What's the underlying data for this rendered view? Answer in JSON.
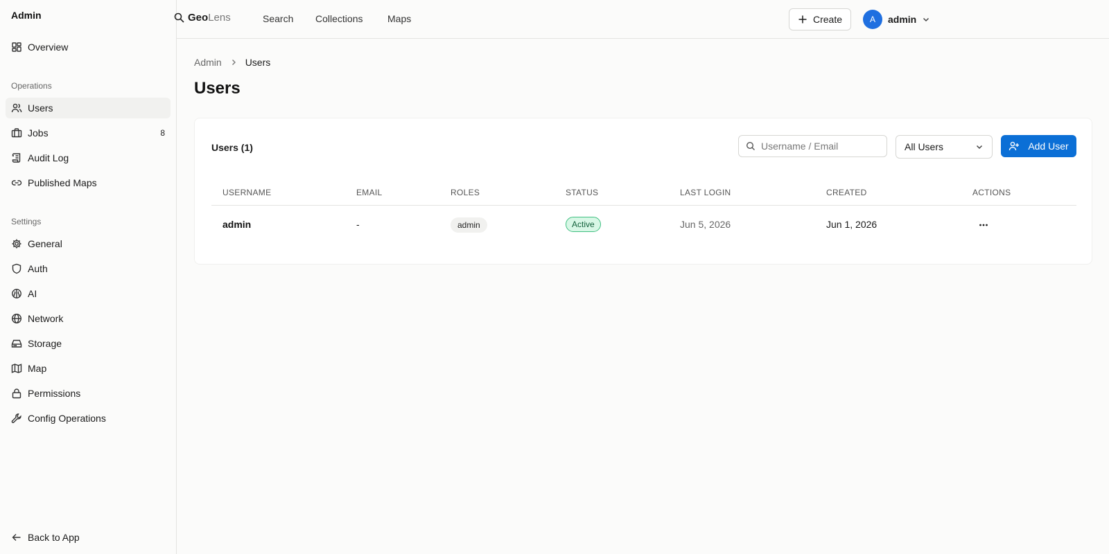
{
  "sidebar": {
    "title": "Admin",
    "overview": {
      "label": "Overview",
      "icon": "dashboard-icon"
    },
    "operations": {
      "heading": "Operations",
      "items": [
        {
          "label": "Users",
          "icon": "users-icon",
          "active": true
        },
        {
          "label": "Jobs",
          "icon": "briefcase-icon",
          "badge": "8"
        },
        {
          "label": "Audit Log",
          "icon": "scroll-icon"
        },
        {
          "label": "Published Maps",
          "icon": "link-icon"
        }
      ]
    },
    "settings": {
      "heading": "Settings",
      "items": [
        {
          "label": "General",
          "icon": "gear-icon"
        },
        {
          "label": "Auth",
          "icon": "shield-icon"
        },
        {
          "label": "AI",
          "icon": "brain-icon"
        },
        {
          "label": "Network",
          "icon": "globe-icon"
        },
        {
          "label": "Storage",
          "icon": "hard-drive-icon"
        },
        {
          "label": "Map",
          "icon": "map-icon"
        },
        {
          "label": "Permissions",
          "icon": "lock-icon"
        },
        {
          "label": "Config Operations",
          "icon": "wrench-icon"
        }
      ]
    },
    "back": {
      "label": "Back to App",
      "icon": "arrow-left-icon"
    }
  },
  "header": {
    "logo_bold": "Geo",
    "logo_light": "Lens",
    "nav": [
      "Search",
      "Collections",
      "Maps"
    ],
    "create_label": "Create",
    "avatar_initial": "A",
    "username": "admin"
  },
  "breadcrumb": {
    "root": "Admin",
    "current": "Users"
  },
  "page_title": "Users",
  "card": {
    "title": "Users (1)",
    "search_placeholder": "Username / Email",
    "filter_value": "All Users",
    "add_label": "Add User"
  },
  "table": {
    "columns": [
      "USERNAME",
      "EMAIL",
      "ROLES",
      "STATUS",
      "LAST LOGIN",
      "CREATED",
      "ACTIONS"
    ],
    "rows": [
      {
        "username": "admin",
        "email": "-",
        "role": "admin",
        "status": "Active",
        "last_login": "Jun 5, 2026",
        "created": "Jun 1, 2026"
      }
    ]
  },
  "colors": {
    "accent": "#0b6fd6",
    "avatar": "#1f6fe0",
    "status_active_bg": "#d8f7e6",
    "status_active_border": "#3fbf80"
  }
}
